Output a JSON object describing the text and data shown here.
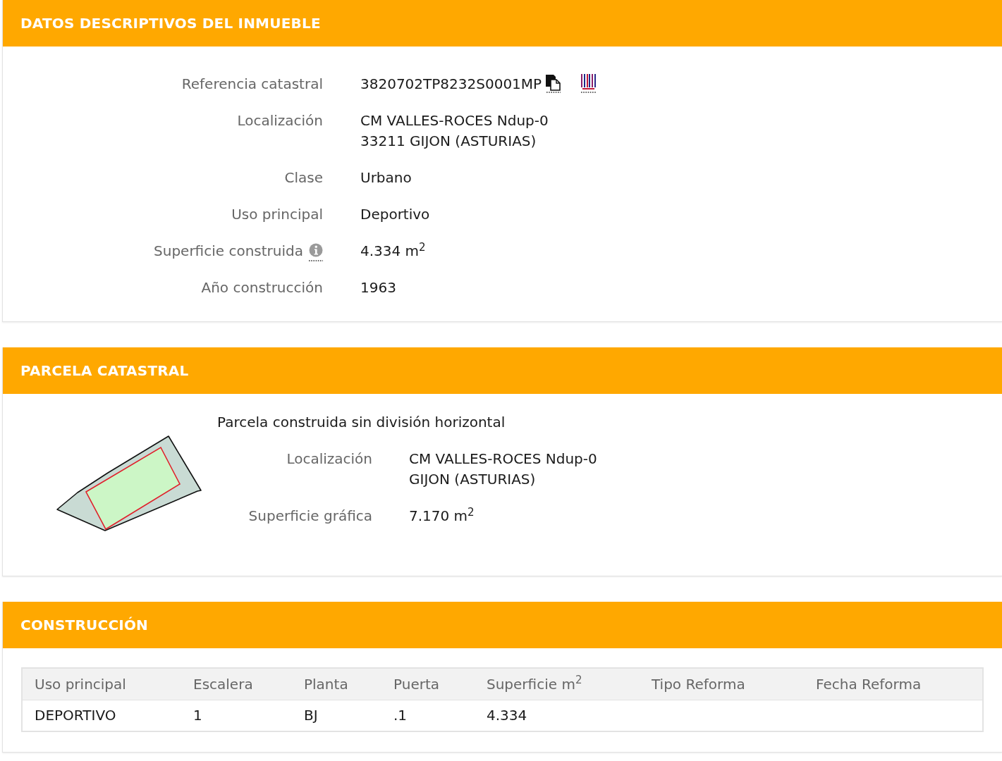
{
  "sections": [
    {
      "kind": "details",
      "title": "DATOS DESCRIPTIVOS DEL INMUEBLE",
      "fields": [
        {
          "kind": "reference",
          "label": "Referencia catastral",
          "lines": [
            "3820702TP8232S0001MP"
          ]
        },
        {
          "kind": "plain",
          "label": "Localización",
          "lines": [
            "CM VALLES-ROCES Ndup-0",
            "33211 GIJON (ASTURIAS)"
          ]
        },
        {
          "kind": "plain",
          "label": "Clase",
          "lines": [
            "Urbano"
          ]
        },
        {
          "kind": "plain",
          "label": "Uso principal",
          "lines": [
            "Deportivo"
          ]
        },
        {
          "kind": "info",
          "label": "Superficie construida",
          "lines": [
            "4.334 m$^{2}$"
          ]
        },
        {
          "kind": "plain",
          "label": "Año construcción",
          "lines": [
            "1963"
          ]
        }
      ]
    },
    {
      "kind": "parcel",
      "title": "PARCELA CATASTRAL",
      "description": "Parcela construida sin división horizontal",
      "fields": [
        {
          "kind": "plain",
          "label": "Localización",
          "lines": [
            "CM VALLES-ROCES Ndup-0",
            "GIJON (ASTURIAS)"
          ]
        },
        {
          "kind": "plain",
          "label": "Superficie gráfica",
          "lines": [
            "7.170 m$^{2}$"
          ]
        }
      ]
    },
    {
      "kind": "table",
      "title": "CONSTRUCCIÓN",
      "table": {
        "columns": [
          "Uso principal",
          "Escalera",
          "Planta",
          "Puerta",
          "Superficie m$^{2}$",
          "Tipo Reforma",
          "Fecha Reforma"
        ],
        "rows": [
          [
            "DEPORTIVO",
            "1",
            "BJ",
            ".1",
            "4.334"
          ]
        ]
      }
    }
  ]
}
